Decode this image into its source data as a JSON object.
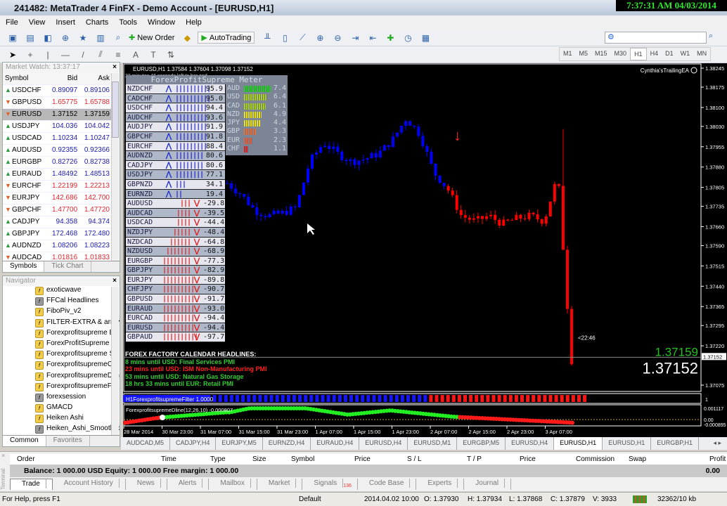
{
  "window": {
    "title": "241482: MetaTrader 4 FinFX - Demo Account - [EURUSD,H1]",
    "clock": "7:37:31 AM 04/03/2014"
  },
  "menu": [
    "File",
    "View",
    "Insert",
    "Charts",
    "Tools",
    "Window",
    "Help"
  ],
  "toolbar": {
    "new_order": "New Order",
    "autotrading": "AutoTrading"
  },
  "timeframes": [
    "M1",
    "M5",
    "M15",
    "M30",
    "H1",
    "H4",
    "D1",
    "W1",
    "MN"
  ],
  "active_timeframe": "H1",
  "market_watch": {
    "title": "Market Watch: 13:37:17",
    "cols": [
      "Symbol",
      "Bid",
      "Ask"
    ],
    "rows": [
      {
        "s": "USDCHF",
        "bid": "0.89097",
        "ask": "0.89106",
        "dir": "up"
      },
      {
        "s": "GBPUSD",
        "bid": "1.65775",
        "ask": "1.65788",
        "dir": "dn"
      },
      {
        "s": "EURUSD",
        "bid": "1.37152",
        "ask": "1.37159",
        "dir": "dn",
        "sel": true
      },
      {
        "s": "USDJPY",
        "bid": "104.036",
        "ask": "104.042",
        "dir": "up"
      },
      {
        "s": "USDCAD",
        "bid": "1.10234",
        "ask": "1.10247",
        "dir": "up"
      },
      {
        "s": "AUDUSD",
        "bid": "0.92355",
        "ask": "0.92366",
        "dir": "up"
      },
      {
        "s": "EURGBP",
        "bid": "0.82726",
        "ask": "0.82738",
        "dir": "up"
      },
      {
        "s": "EURAUD",
        "bid": "1.48492",
        "ask": "1.48513",
        "dir": "up"
      },
      {
        "s": "EURCHF",
        "bid": "1.22199",
        "ask": "1.22213",
        "dir": "dn"
      },
      {
        "s": "EURJPY",
        "bid": "142.686",
        "ask": "142.700",
        "dir": "dn"
      },
      {
        "s": "GBPCHF",
        "bid": "1.47700",
        "ask": "1.47720",
        "dir": "dn"
      },
      {
        "s": "CADJPY",
        "bid": "94.358",
        "ask": "94.374",
        "dir": "up"
      },
      {
        "s": "GBPJPY",
        "bid": "172.468",
        "ask": "172.480",
        "dir": "up"
      },
      {
        "s": "AUDNZD",
        "bid": "1.08206",
        "ask": "1.08223",
        "dir": "up"
      },
      {
        "s": "AUDCAD",
        "bid": "1.01816",
        "ask": "1.01833",
        "dir": "dn"
      }
    ],
    "tabs": [
      "Symbols",
      "Tick Chart"
    ]
  },
  "navigator": {
    "title": "Navigator",
    "items": [
      {
        "n": "exoticwave",
        "g": false
      },
      {
        "n": "FFCal Headlines",
        "g": true
      },
      {
        "n": "FiboPiv_v2",
        "g": false
      },
      {
        "n": "FILTER-EXTRA & arrow",
        "g": false
      },
      {
        "n": "Forexprofitsupreme Ba",
        "g": false
      },
      {
        "n": "ForexProfitSupreme M",
        "g": false
      },
      {
        "n": "Forexprofitsupreme Si",
        "g": false
      },
      {
        "n": "ForexprofitsupremeClo",
        "g": false
      },
      {
        "n": "ForexprofitsupremeDlin",
        "g": false
      },
      {
        "n": "ForexprofitsupremeFilt",
        "g": false
      },
      {
        "n": "forexsession",
        "g": true
      },
      {
        "n": "GMACD",
        "g": false
      },
      {
        "n": "Heiken Ashi",
        "g": false
      },
      {
        "n": "Heiken_Ashi_Smoothed",
        "g": true
      }
    ],
    "tabs": [
      "Common",
      "Favorites"
    ]
  },
  "chart": {
    "header": "EURUSD,H1  1.37584 1.37604 1.37098 1.37152",
    "bar_timer": "22 minutes 46 seconds left to bar end",
    "ea": "Cynthia'sTrailingEA",
    "ask": "1.37159",
    "bid": "1.37152",
    "bid_tag": "1.37152",
    "countdown": "<22:46",
    "price_ticks": [
      "1.38245",
      "1.38175",
      "1.38100",
      "1.38030",
      "1.37955",
      "1.37880",
      "1.37805",
      "1.37735",
      "1.37660",
      "1.37590",
      "1.37515",
      "1.37440",
      "1.37365",
      "1.37295",
      "1.37220",
      "1.37075"
    ],
    "time_ticks": [
      "28 Mar 2014",
      "30 Mar 23:00",
      "31 Mar 07:00",
      "31 Mar 15:00",
      "31 Mar 23:00",
      "1 Apr 07:00",
      "1 Apr 15:00",
      "1 Apr 23:00",
      "2 Apr 07:00",
      "2 Apr 15:00",
      "2 Apr 23:00",
      "3 Apr 07:00"
    ],
    "filter_label": "H1ForexprofitsupremeFilter 1.0000",
    "filter_axis": "1",
    "dline_label": "ForexprofitsupremeDline(12,26,10) -0.000807",
    "dline_ticks": [
      "0.001117",
      "0.00",
      "-0.000895"
    ],
    "price_path": [
      1.3782,
      1.3778,
      1.3772,
      1.377,
      1.3771,
      1.3773,
      1.379,
      1.3797,
      1.3793,
      1.379,
      1.3791,
      1.3793,
      1.3798,
      1.3806,
      1.38,
      1.3786,
      1.378,
      1.377,
      1.3768,
      1.377,
      1.3767,
      1.3769,
      1.377,
      1.3768,
      1.3785,
      1.37152
    ],
    "signal_arrow": "down"
  },
  "meter": {
    "title": "ForexProfitSupreme Meter",
    "pairs": [
      [
        "NZDCHF",
        95.9
      ],
      [
        "CADCHF",
        95.0
      ],
      [
        "USDCHF",
        94.4
      ],
      [
        "AUDCHF",
        93.6
      ],
      [
        "AUDJPY",
        91.9
      ],
      [
        "GBPCHF",
        91.8
      ],
      [
        "EURCHF",
        88.4
      ],
      [
        "AUDNZD",
        80.6
      ],
      [
        "CADJPY",
        80.6
      ],
      [
        "USDJPY",
        77.1
      ],
      [
        "GBPNZD",
        34.1
      ],
      [
        "EURNZD",
        19.4
      ],
      [
        "AUDUSD",
        -29.8
      ],
      [
        "AUDCAD",
        -39.5
      ],
      [
        "USDCAD",
        -44.4
      ],
      [
        "NZDJPY",
        -48.4
      ],
      [
        "NZDCAD",
        -64.8
      ],
      [
        "NZDUSD",
        -68.9
      ],
      [
        "EURGBP",
        -77.3
      ],
      [
        "GBPJPY",
        -82.9
      ],
      [
        "EURJPY",
        -89.8
      ],
      [
        "CHFJPY",
        -90.7
      ],
      [
        "GBPUSD",
        -91.7
      ],
      [
        "EURAUD",
        -93.0
      ],
      [
        "EURCAD",
        -94.4
      ],
      [
        "EURUSD",
        -94.4
      ],
      [
        "GBPAUD",
        -97.7
      ]
    ],
    "currencies": [
      [
        "AUD",
        7.4,
        "#22cc22"
      ],
      [
        "USD",
        6.4,
        "#a8d020"
      ],
      [
        "CAD",
        6.1,
        "#a8d020"
      ],
      [
        "NZD",
        4.9,
        "#e8e020"
      ],
      [
        "JPY",
        4.4,
        "#e8e020"
      ],
      [
        "GBP",
        3.3,
        "#e07040"
      ],
      [
        "EUR",
        2.3,
        "#e06040"
      ],
      [
        "CHF",
        1.1,
        "#e02020"
      ]
    ]
  },
  "news": {
    "title": "FOREX FACTORY CALENDAR HEADLINES:",
    "items": [
      {
        "t": "8 mins until USD: Final Services PMI",
        "c": "#33cc33"
      },
      {
        "t": "23 mins until USD: ISM Non-Manufacturing PMI",
        "c": "#ff2020"
      },
      {
        "t": "53 mins until USD: Natural Gas Storage",
        "c": "#33cc33"
      },
      {
        "t": "18 hrs 33 mins until EUR: Retail PMI",
        "c": "#33cc33"
      }
    ]
  },
  "chart_tabs": [
    "AUDCAD,M5",
    "CADJPY,H4",
    "EURJPY,M5",
    "EURNZD,H4",
    "EURAUD,H4",
    "EURUSD,H4",
    "EURUSD,M1",
    "EURGBP,M5",
    "EURUSD,H4",
    "EURUSD,H1",
    "EURUSD,H1",
    "EURGBP,H1"
  ],
  "active_chart_tab": 9,
  "terminal": {
    "cols": [
      "Order",
      "Time",
      "Type",
      "Size",
      "Symbol",
      "Price",
      "S / L",
      "T / P",
      "Price",
      "Commission",
      "Swap",
      "Profit"
    ],
    "balance": "Balance: 1 000.00 USD  Equity: 1 000.00  Free margin: 1 000.00",
    "profit": "0.00",
    "side_label": "Terminal",
    "tabs": [
      "Trade",
      "Account History",
      "News",
      "Alerts",
      "Mailbox",
      "Market",
      "Signals",
      "Code Base",
      "Experts",
      "Journal"
    ],
    "signals_badge": "136"
  },
  "status": {
    "help": "For Help, press F1",
    "profile": "Default",
    "time": "2014.04.02 10:00",
    "o": "O: 1.37930",
    "h": "H: 1.37934",
    "l": "L: 1.37868",
    "c": "C: 1.37879",
    "v": "V: 3933",
    "traffic": "32362/10 kb"
  },
  "colors": {
    "bull": "#0000ff",
    "bear": "#ff0000",
    "ask": "#22c022",
    "meter_bg": "#7b8595"
  }
}
